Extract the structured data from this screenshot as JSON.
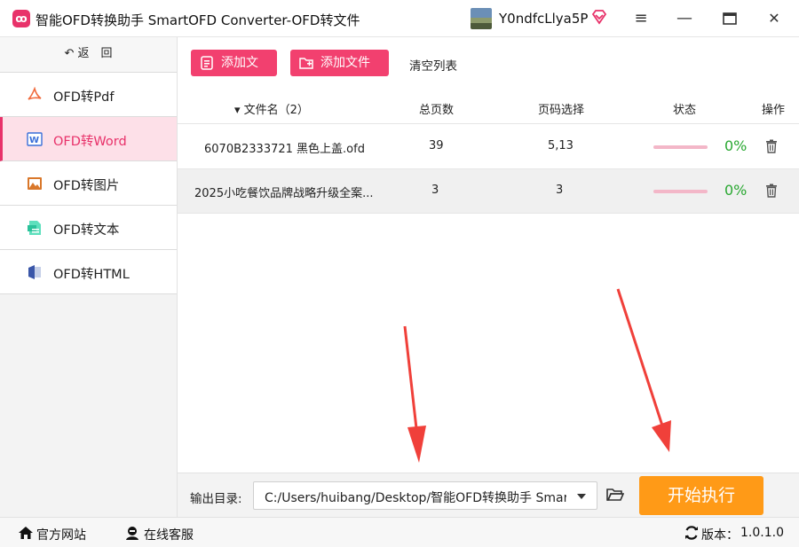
{
  "window": {
    "title": "智能OFD转换助手 SmartOFD Converter-OFD转文件",
    "logo_glyph": "ꝏ",
    "username": "Y0ndfcLlya5P",
    "minimize_glyph": "≡",
    "min2_glyph": "—",
    "close_glyph": "✕"
  },
  "sidebar": {
    "back_label": "返　回",
    "items": [
      {
        "label": "OFD转Pdf",
        "icon": "pdf-icon",
        "color": "#f06a3c"
      },
      {
        "label": "OFD转Word",
        "icon": "word-icon",
        "color": "#3a6fd8"
      },
      {
        "label": "OFD转图片",
        "icon": "image-icon",
        "color": "#d9772a"
      },
      {
        "label": "OFD转文本",
        "icon": "text-icon",
        "color": "#2bc29a"
      },
      {
        "label": "OFD转HTML",
        "icon": "html-icon",
        "color": "#3a56a8"
      }
    ],
    "active_index": 1
  },
  "toolbar": {
    "add_file_label": "添加文件",
    "add_folder_label": "添加文件夹",
    "clear_label": "清空列表"
  },
  "table": {
    "headers": {
      "filename": "▾ 文件名（2）",
      "pages": "总页数",
      "page_select": "页码选择",
      "status": "状态",
      "actions": "操作"
    },
    "rows": [
      {
        "filename": "6070B2333721 黑色上盖.ofd",
        "pages": "39",
        "page_select": "5,13",
        "progress": "0%"
      },
      {
        "filename": "2025小吃餐饮品牌战略升级全案...",
        "pages": "3",
        "page_select": "3",
        "progress": "0%"
      }
    ]
  },
  "output": {
    "label": "输出目录:",
    "path": "C:/Users/huibang/Desktop/智能OFD转换助手 SmartOFD",
    "start_label": "开始执行"
  },
  "statusbar": {
    "website_label": "官方网站",
    "support_label": "在线客服",
    "version_label": "版本：",
    "version": "1.0.1.0"
  },
  "colors": {
    "accent": "#f2406f",
    "start": "#ff9a17",
    "progress_text": "#2aa832"
  }
}
